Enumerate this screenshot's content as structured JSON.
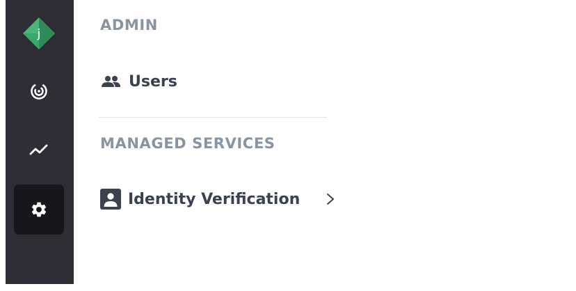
{
  "sidebar": {
    "logo": {
      "letter": "j",
      "colors": {
        "left": "#3aa86b",
        "right": "#2d7f55",
        "top": "#4fc07e"
      }
    },
    "items": [
      {
        "icon": "radar-icon",
        "active": false
      },
      {
        "icon": "trend-chart-icon",
        "active": false
      },
      {
        "icon": "gear-icon",
        "active": true
      }
    ]
  },
  "main": {
    "admin_title": "ADMIN",
    "users_label": "Users",
    "users_icon": "users-icon",
    "managed_title": "MANAGED SERVICES",
    "identity_label": "Identity Verification",
    "identity_icon": "id-card-icon",
    "identity_chevron": "chevron-right-icon"
  },
  "colors": {
    "rail_bg": "#2e2e34",
    "rail_active_bg": "#17171b",
    "section_title": "#8a94a1",
    "item_text": "#3a4250"
  }
}
